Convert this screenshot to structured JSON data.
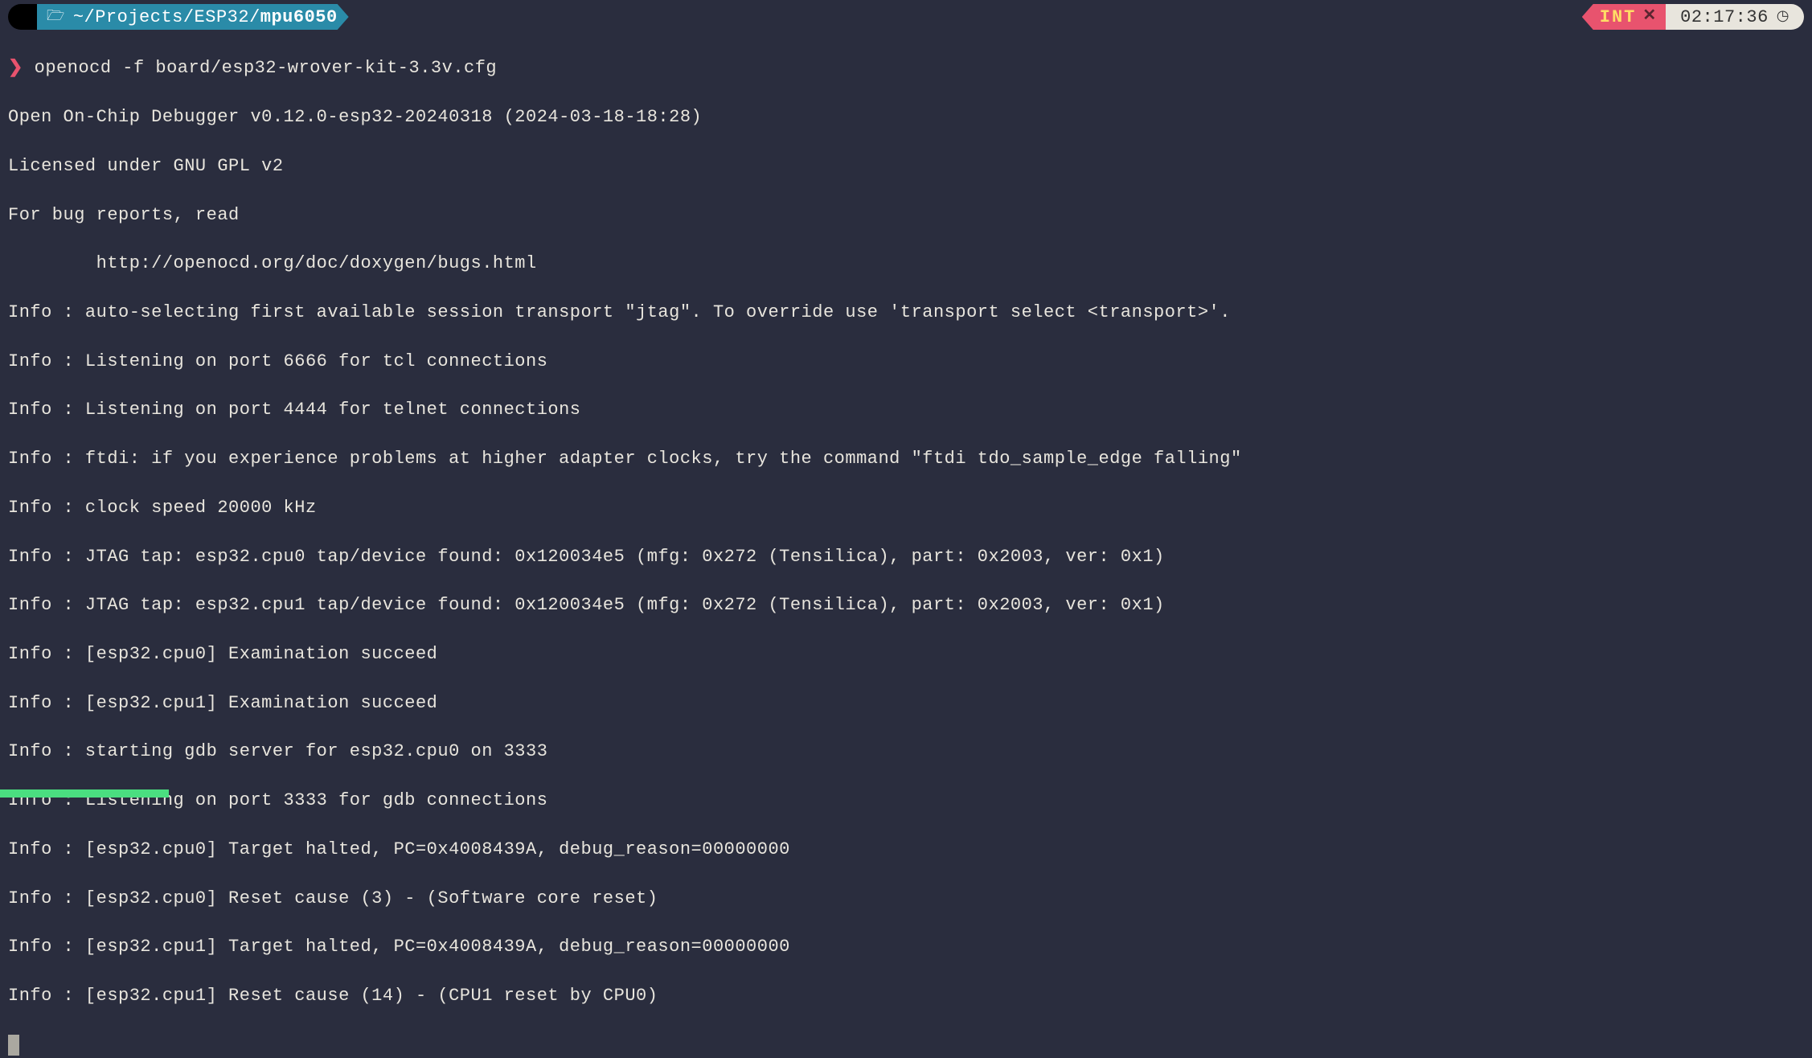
{
  "header": {
    "path_prefix": "~/Projects/ESP32/",
    "path_current": "mpu6050",
    "mode_badge": "INT",
    "time": "02:17:36"
  },
  "prompt": {
    "symbol": "❯",
    "command": "openocd -f board/esp32-wrover-kit-3.3v.cfg"
  },
  "output": {
    "lines": [
      "Open On-Chip Debugger v0.12.0-esp32-20240318 (2024-03-18-18:28)",
      "Licensed under GNU GPL v2",
      "For bug reports, read",
      "        http://openocd.org/doc/doxygen/bugs.html",
      "Info : auto-selecting first available session transport \"jtag\". To override use 'transport select <transport>'.",
      "Info : Listening on port 6666 for tcl connections",
      "Info : Listening on port 4444 for telnet connections",
      "Info : ftdi: if you experience problems at higher adapter clocks, try the command \"ftdi tdo_sample_edge falling\"",
      "Info : clock speed 20000 kHz",
      "Info : JTAG tap: esp32.cpu0 tap/device found: 0x120034e5 (mfg: 0x272 (Tensilica), part: 0x2003, ver: 0x1)",
      "Info : JTAG tap: esp32.cpu1 tap/device found: 0x120034e5 (mfg: 0x272 (Tensilica), part: 0x2003, ver: 0x1)",
      "Info : [esp32.cpu0] Examination succeed",
      "Info : [esp32.cpu1] Examination succeed",
      "Info : starting gdb server for esp32.cpu0 on 3333",
      "Info : Listening on port 3333 for gdb connections",
      "Info : [esp32.cpu0] Target halted, PC=0x4008439A, debug_reason=00000000",
      "Info : [esp32.cpu0] Reset cause (3) - (Software core reset)",
      "Info : [esp32.cpu1] Target halted, PC=0x4008439A, debug_reason=00000000",
      "Info : [esp32.cpu1] Reset cause (14) - (CPU1 reset by CPU0)"
    ]
  }
}
